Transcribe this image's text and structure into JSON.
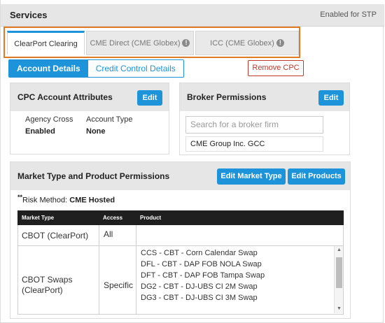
{
  "header": {
    "title": "Services",
    "status": "Enabled for STP"
  },
  "tabs": [
    {
      "label": "ClearPort Clearing",
      "info": false
    },
    {
      "label": "CME Direct (CME Globex)",
      "info": true
    },
    {
      "label": "ICC (CME Globex)",
      "info": true
    }
  ],
  "subtabs": {
    "account_details": "Account Details",
    "credit_control": "Credit Control Details"
  },
  "remove_label": "Remove CPC",
  "cpc": {
    "title": "CPC Account Attributes",
    "edit_label": "Edit",
    "agency_cross_label": "Agency Cross",
    "agency_cross_value": "Enabled",
    "account_type_label": "Account Type",
    "account_type_value": "None"
  },
  "broker": {
    "title": "Broker Permissions",
    "edit_label": "Edit",
    "search_placeholder": "Search for a broker firm",
    "items": [
      "CME Group Inc. GCC"
    ]
  },
  "market": {
    "title": "Market Type and Product Permissions",
    "edit_market_label": "Edit Market Type",
    "edit_products_label": "Edit Products",
    "risk_mark": "**",
    "risk_label": "Risk Method: ",
    "risk_value": "CME Hosted",
    "columns": [
      "Market Type",
      "Access",
      "Product"
    ],
    "rows": [
      {
        "market": "CBOT (ClearPort)",
        "access": "All",
        "products": []
      },
      {
        "market": "CBOT Swaps (ClearPort)",
        "access": "Specific",
        "products": [
          "CCS - CBT - Corn Calendar Swap",
          "DFL - CBT - DAP FOB NOLA Swap",
          "DFT - CBT - DAP FOB Tampa Swap",
          "DG2 - CBT - DJ-UBS CI 2M Swap",
          "DG3 - CBT - DJ-UBS CI 3M Swap"
        ]
      }
    ]
  },
  "colors": {
    "accent": "#1d93d9",
    "highlight": "#e07b23",
    "danger": "#c0392b"
  },
  "icons": {
    "tab_info": "info-circle-icon",
    "scroll_up": "scroll-up-arrow-icon",
    "scroll_down": "scroll-down-arrow-icon"
  }
}
